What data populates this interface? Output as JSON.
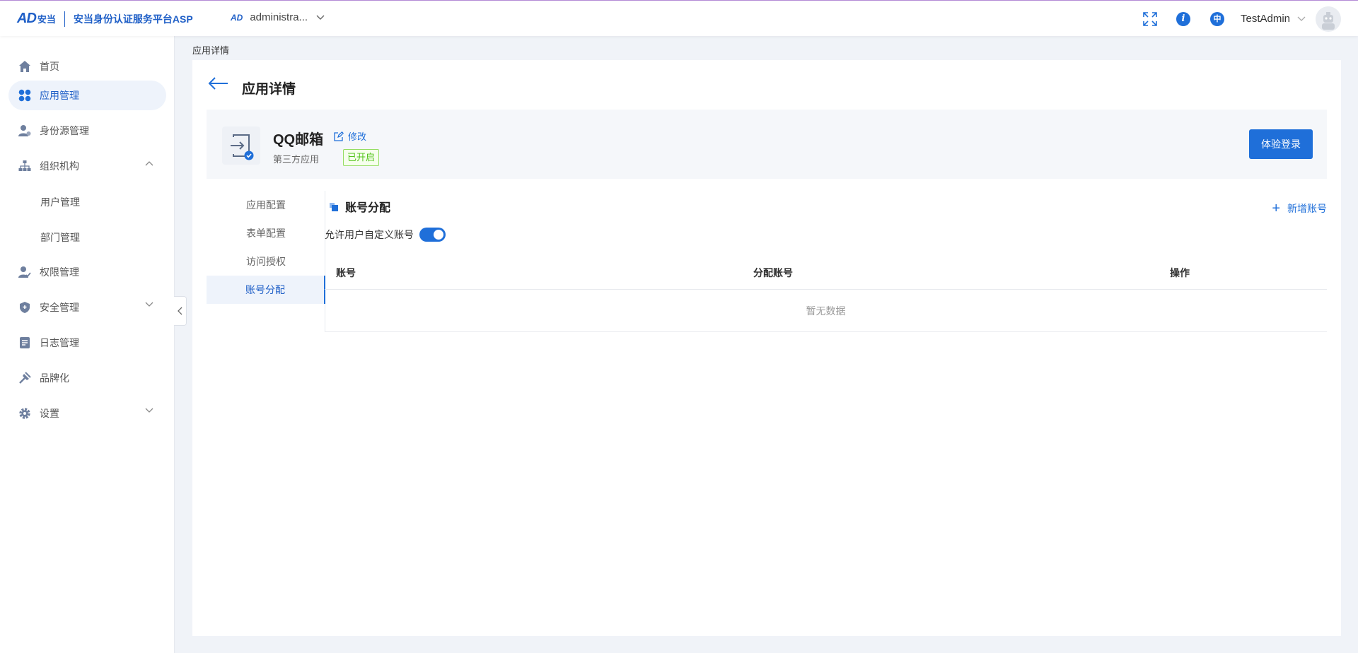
{
  "header": {
    "logo_text": "安当",
    "brand_title": "安当身份认证服务平台ASP",
    "tenant_name": "administra...",
    "user_name": "TestAdmin",
    "lang_label": "中",
    "info_label": "i"
  },
  "sidebar": {
    "items": [
      {
        "label": "首页",
        "icon": "home-icon"
      },
      {
        "label": "应用管理",
        "icon": "apps-icon",
        "active": true
      },
      {
        "label": "身份源管理",
        "icon": "identity-source-icon"
      },
      {
        "label": "组织机构",
        "icon": "org-icon",
        "expanded": true
      },
      {
        "label": "权限管理",
        "icon": "permission-icon"
      },
      {
        "label": "安全管理",
        "icon": "shield-icon"
      },
      {
        "label": "日志管理",
        "icon": "log-icon"
      },
      {
        "label": "品牌化",
        "icon": "brand-icon"
      },
      {
        "label": "设置",
        "icon": "gear-icon"
      }
    ],
    "sub_items": [
      "用户管理",
      "部门管理"
    ]
  },
  "breadcrumb": "应用详情",
  "page_title": "应用详情",
  "app": {
    "name": "QQ邮箱",
    "edit_label": "修改",
    "type": "第三方应用",
    "status": "已开启",
    "trial_button": "体验登录"
  },
  "subnav": {
    "items": [
      "应用配置",
      "表单配置",
      "访问授权",
      "账号分配"
    ],
    "active": "账号分配"
  },
  "section": {
    "title": "账号分配",
    "add_label": "新增账号",
    "toggle_label": "允许用户自定义账号",
    "toggle_on": true
  },
  "table": {
    "columns": [
      "账号",
      "分配账号",
      "操作"
    ],
    "empty_text": "暂无数据"
  },
  "colors": {
    "primary": "#1f6fd9",
    "brand": "#1f5fc7",
    "success": "#52c41a"
  }
}
